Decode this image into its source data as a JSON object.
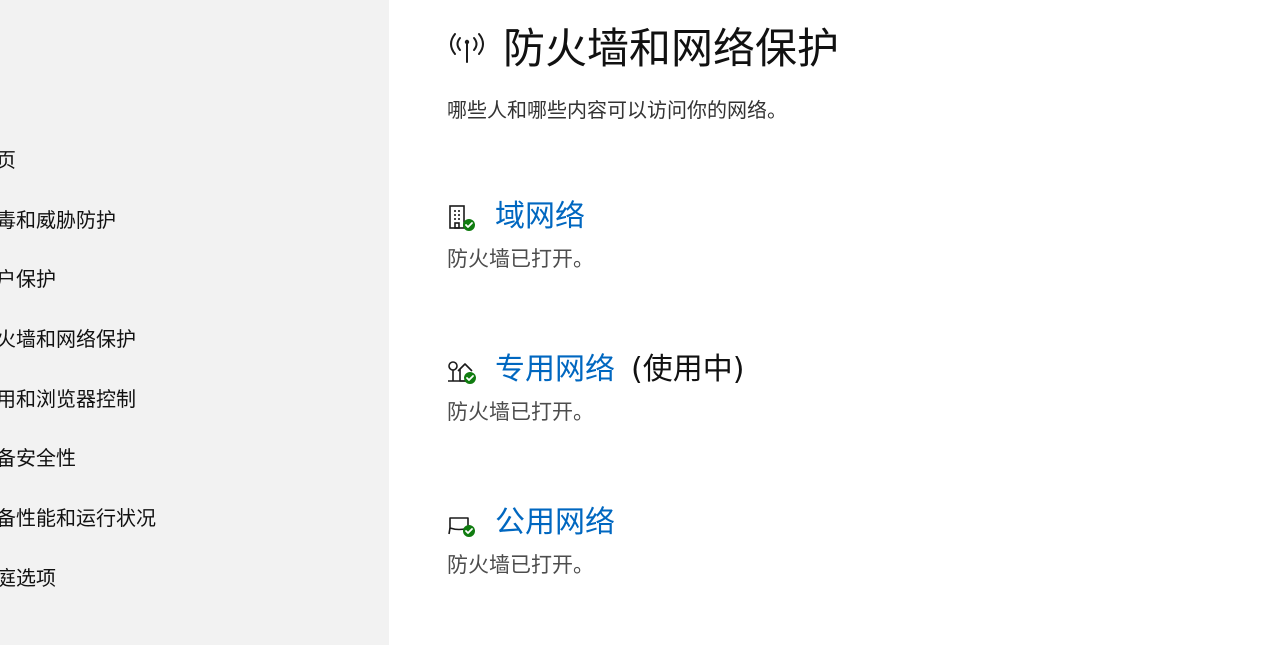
{
  "sidebar": {
    "items": [
      {
        "label": "主页"
      },
      {
        "label": "病毒和威胁防护"
      },
      {
        "label": "帐户保护"
      },
      {
        "label": "防火墙和网络保护"
      },
      {
        "label": "应用和浏览器控制"
      },
      {
        "label": "设备安全性"
      },
      {
        "label": "设备性能和运行状况"
      },
      {
        "label": "家庭选项"
      }
    ]
  },
  "header": {
    "icon": "wireless-antenna-icon",
    "title": "防火墙和网络保护",
    "subtitle": "哪些人和哪些内容可以访问你的网络。"
  },
  "networks": [
    {
      "icon": "domain-building-check-icon",
      "title": "域网络",
      "suffix": "",
      "status": "防火墙已打开。"
    },
    {
      "icon": "private-home-check-icon",
      "title": "专用网络",
      "suffix": "(使用中)",
      "status": "防火墙已打开。"
    },
    {
      "icon": "public-bench-check-icon",
      "title": "公用网络",
      "suffix": "",
      "status": "防火墙已打开。"
    }
  ],
  "colors": {
    "accent": "#0067c0",
    "check": "#107c10",
    "sidebar_bg": "#f2f2f2"
  }
}
